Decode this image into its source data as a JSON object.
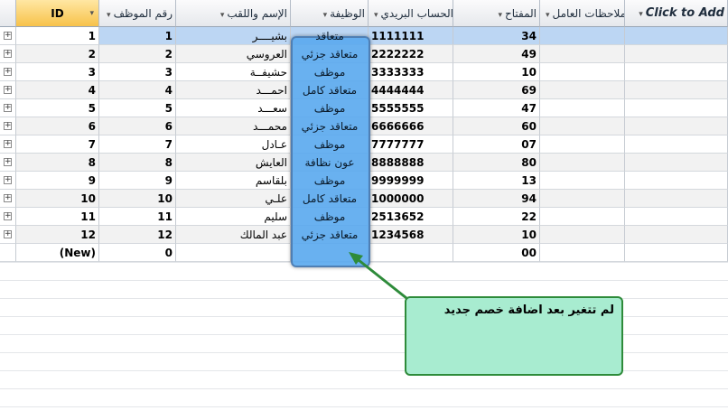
{
  "columns": [
    {
      "key": "id",
      "label": "ID",
      "sort": "▾"
    },
    {
      "key": "emp_no",
      "label": "رقم الموظف",
      "sort": "▾"
    },
    {
      "key": "name",
      "label": "الإسم واللقب",
      "sort": "▾"
    },
    {
      "key": "job",
      "label": "الوظيفة",
      "sort": "▾"
    },
    {
      "key": "post",
      "label": "رقم الحساب البريدي",
      "sort": "▾"
    },
    {
      "key": "key",
      "label": "المفتاح",
      "sort": "▾"
    },
    {
      "key": "notes",
      "label": "ملاحظات العامل",
      "sort": "▾"
    },
    {
      "key": "add",
      "label": "Click to Add",
      "sort": "▾"
    }
  ],
  "rows": [
    {
      "id": "1",
      "emp_no": "1",
      "name": "بشيــــر",
      "job": "متعاقد",
      "post": "1111111",
      "key": "34"
    },
    {
      "id": "2",
      "emp_no": "2",
      "name": "العروسي",
      "job": "متعاقد جزئي",
      "post": "2222222",
      "key": "49"
    },
    {
      "id": "3",
      "emp_no": "3",
      "name": "حشيفــة",
      "job": "موظف",
      "post": "3333333",
      "key": "10"
    },
    {
      "id": "4",
      "emp_no": "4",
      "name": "احمـــد",
      "job": "متعاقد كامل",
      "post": "4444444",
      "key": "69"
    },
    {
      "id": "5",
      "emp_no": "5",
      "name": "سعـــد",
      "job": "موظف",
      "post": "5555555",
      "key": "47"
    },
    {
      "id": "6",
      "emp_no": "6",
      "name": "محمـــد",
      "job": "متعاقد جزئي",
      "post": "6666666",
      "key": "60"
    },
    {
      "id": "7",
      "emp_no": "7",
      "name": "عـادل",
      "job": "موظف",
      "post": "7777777",
      "key": "07"
    },
    {
      "id": "8",
      "emp_no": "8",
      "name": "العايش",
      "job": "عون نظافة",
      "post": "8888888",
      "key": "80"
    },
    {
      "id": "9",
      "emp_no": "9",
      "name": "بلقاسم",
      "job": "موظف",
      "post": "9999999",
      "key": "13"
    },
    {
      "id": "10",
      "emp_no": "10",
      "name": "علـي",
      "job": "متعاقد كامل",
      "post": "1000000",
      "key": "94"
    },
    {
      "id": "11",
      "emp_no": "11",
      "name": "سليم",
      "job": "موظف",
      "post": "2513652",
      "key": "22"
    },
    {
      "id": "12",
      "emp_no": "12",
      "name": "عبد المالك",
      "job": "متعاقد جزئي",
      "post": "1234568",
      "key": "10"
    }
  ],
  "new_row": {
    "id": "(New)",
    "emp_no": "0",
    "key": "00"
  },
  "expand_symbol": "+",
  "callout_text": "لم تتغير بعد اضافة خصم جديد",
  "colors": {
    "highlight": "#59a8ee",
    "callout_bg": "#a8ecd0",
    "callout_border": "#2e8b3a",
    "arrow": "#2e8b3a",
    "selected_row": "#bcd6f3"
  }
}
